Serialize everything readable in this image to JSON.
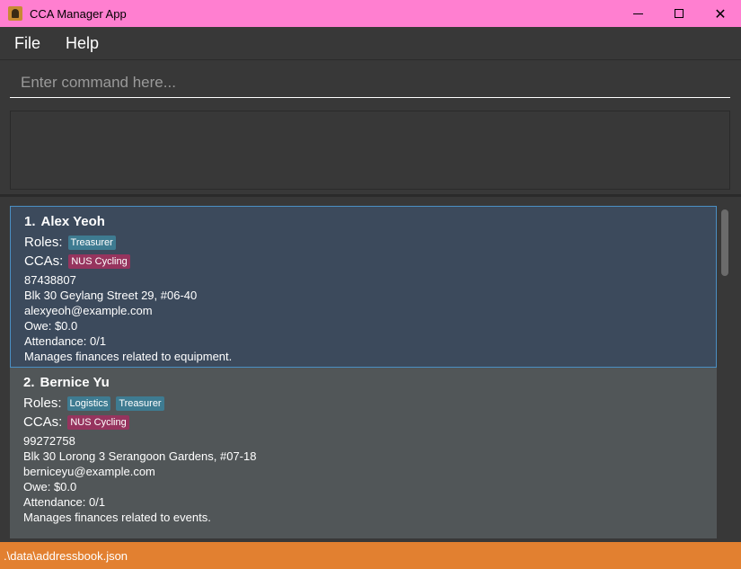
{
  "window": {
    "title": "CCA Manager App"
  },
  "menu": {
    "file": "File",
    "help": "Help"
  },
  "command": {
    "placeholder": "Enter command here...",
    "value": ""
  },
  "result": {
    "text": ""
  },
  "persons": [
    {
      "index": "1.",
      "name": "Alex Yeoh",
      "roles_label": "Roles:",
      "roles": [
        "Treasurer"
      ],
      "ccas_label": "CCAs:",
      "ccas": [
        "NUS Cycling"
      ],
      "phone": "87438807",
      "address": "Blk 30 Geylang Street 29, #06-40",
      "email": "alexyeoh@example.com",
      "owe": "Owe: $0.0",
      "attendance": "Attendance: 0/1",
      "remark": "Manages finances related to equipment."
    },
    {
      "index": "2.",
      "name": "Bernice Yu",
      "roles_label": "Roles:",
      "roles": [
        "Logistics",
        "Treasurer"
      ],
      "ccas_label": "CCAs:",
      "ccas": [
        "NUS Cycling"
      ],
      "phone": "99272758",
      "address": "Blk 30 Lorong 3 Serangoon Gardens, #07-18",
      "email": "berniceyu@example.com",
      "owe": "Owe: $0.0",
      "attendance": "Attendance: 0/1",
      "remark": "Manages finances related to events."
    }
  ],
  "status": {
    "path": ".\\data\\addressbook.json"
  },
  "colors": {
    "titlebar": "#ff7fd0",
    "statusbar": "#e28030",
    "selected_card": "#3c4a5c",
    "role_tag": "#3e7b91",
    "cca_tag": "#96345e"
  },
  "icons": [
    "app-icon",
    "minimize-icon",
    "maximize-icon",
    "close-icon"
  ]
}
